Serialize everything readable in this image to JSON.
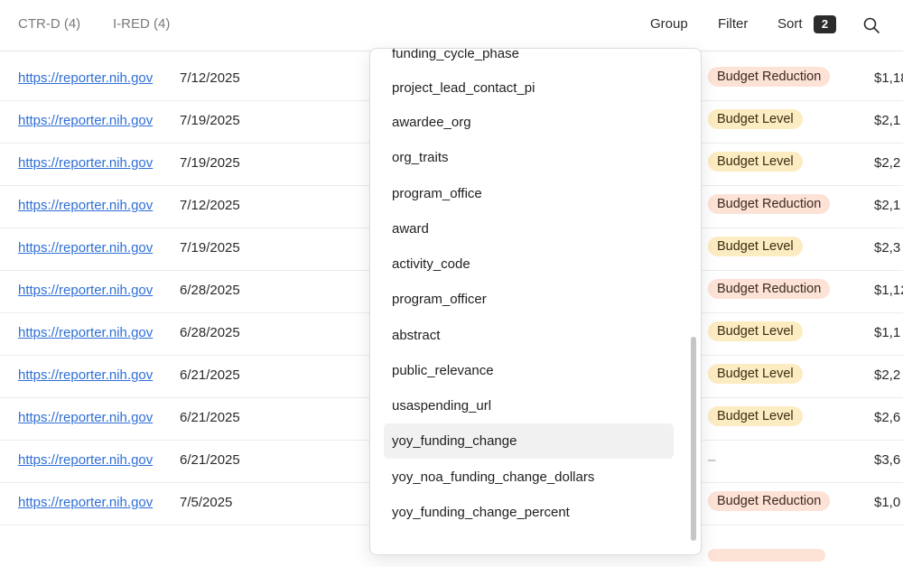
{
  "tabs": [
    {
      "label": "CTR-D (4)"
    },
    {
      "label": "I-RED (4)"
    }
  ],
  "toolbar": {
    "group_label": "Group",
    "filter_label": "Filter",
    "sort_label": "Sort",
    "sort_count": "2",
    "search_icon": "search-icon"
  },
  "rows": [
    {
      "link": "https://reporter.nih.gov",
      "date": "7/12/2025",
      "status": "Budget Reduction",
      "amount": "$1,18"
    },
    {
      "link": "https://reporter.nih.gov",
      "date": "7/19/2025",
      "status": "Budget Level",
      "amount": "$2,1"
    },
    {
      "link": "https://reporter.nih.gov",
      "date": "7/19/2025",
      "status": "Budget Level",
      "amount": "$2,2"
    },
    {
      "link": "https://reporter.nih.gov",
      "date": "7/12/2025",
      "status": "Budget Reduction",
      "amount": "$2,1"
    },
    {
      "link": "https://reporter.nih.gov",
      "date": "7/19/2025",
      "status": "Budget Level",
      "amount": "$2,3"
    },
    {
      "link": "https://reporter.nih.gov",
      "date": "6/28/2025",
      "status": "Budget Reduction",
      "amount": "$1,12"
    },
    {
      "link": "https://reporter.nih.gov",
      "date": "6/28/2025",
      "status": "Budget Level",
      "amount": "$1,1"
    },
    {
      "link": "https://reporter.nih.gov",
      "date": "6/21/2025",
      "status": "Budget Level",
      "amount": "$2,2"
    },
    {
      "link": "https://reporter.nih.gov",
      "date": "6/21/2025",
      "status": "Budget Level",
      "amount": "$2,6"
    },
    {
      "link": "https://reporter.nih.gov",
      "date": "6/21/2025",
      "status": "–",
      "amount": "$3,6"
    },
    {
      "link": "https://reporter.nih.gov",
      "date": "7/5/2025",
      "status": "Budget Reduction",
      "amount": "$1,0"
    }
  ],
  "dropdown": {
    "items": [
      "funding_cycle_phase",
      "project_lead_contact_pi",
      "awardee_org",
      "org_traits",
      "program_office",
      "award",
      "activity_code",
      "program_officer",
      "abstract",
      "public_relevance",
      "usaspending_url",
      "yoy_funding_change",
      "yoy_noa_funding_change_dollars",
      "yoy_funding_change_percent"
    ],
    "active_item": "yoy_funding_change"
  },
  "colors": {
    "link": "#2f6fd6",
    "badge_reduction": "#fde2d6",
    "badge_level": "#fdebc2"
  }
}
